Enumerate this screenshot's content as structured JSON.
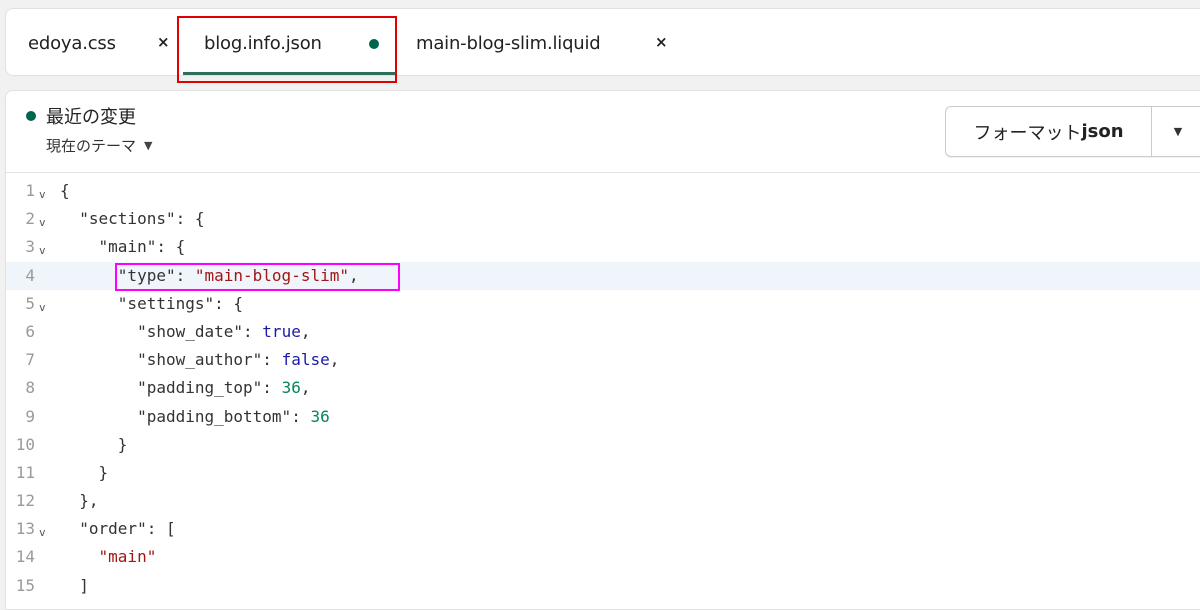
{
  "tabs": [
    {
      "label": "edoya.css",
      "close": "×"
    },
    {
      "label": "blog.info.json",
      "modified": true
    },
    {
      "label": "main-blog-slim.liquid",
      "close": "×"
    }
  ],
  "header": {
    "recent_changes": "最近の変更",
    "theme_select": "現在のテーマ",
    "format_button_prefix": "フォーマット",
    "format_button_suffix": "json"
  },
  "colors": {
    "accent": "#00654d",
    "annotation_red": "#e00000",
    "annotation_pink": "#ff00ff",
    "string": "#a31515",
    "keyword": "#1a1aa6",
    "number": "#098658"
  },
  "icons": {
    "modified_dot": "dot-icon",
    "close": "close-icon",
    "fold": "chevron-down-icon",
    "dropdown": "caret-down-icon"
  },
  "code": {
    "active_line": 4,
    "lines": [
      {
        "n": "1",
        "fold": true
      },
      {
        "n": "2",
        "fold": true
      },
      {
        "n": "3",
        "fold": true
      },
      {
        "n": "4",
        "fold": false
      },
      {
        "n": "5",
        "fold": true
      },
      {
        "n": "6",
        "fold": false
      },
      {
        "n": "7",
        "fold": false
      },
      {
        "n": "8",
        "fold": false
      },
      {
        "n": "9",
        "fold": false
      },
      {
        "n": "10",
        "fold": false
      },
      {
        "n": "11",
        "fold": false
      },
      {
        "n": "12",
        "fold": false
      },
      {
        "n": "13",
        "fold": true
      },
      {
        "n": "14",
        "fold": false
      },
      {
        "n": "15",
        "fold": false
      }
    ],
    "tokens": {
      "l1": "{",
      "l2_key": "\"sections\"",
      "l2_rest": ": {",
      "l3_key": "\"main\"",
      "l3_rest": ": {",
      "l4_key": "\"type\"",
      "l4_sep": ": ",
      "l4_val": "\"main-blog-slim\"",
      "l4_end": ",",
      "l5_key": "\"settings\"",
      "l5_rest": ": {",
      "l6_key": "\"show_date\"",
      "l6_sep": ": ",
      "l6_val": "true",
      "l6_end": ",",
      "l7_key": "\"show_author\"",
      "l7_sep": ": ",
      "l7_val": "false",
      "l7_end": ",",
      "l8_key": "\"padding_top\"",
      "l8_sep": ": ",
      "l8_val": "36",
      "l8_end": ",",
      "l9_key": "\"padding_bottom\"",
      "l9_sep": ": ",
      "l9_val": "36",
      "l10": "}",
      "l11": "}",
      "l12": "},",
      "l13_key": "\"order\"",
      "l13_rest": ": [",
      "l14_val": "\"main\"",
      "l15": "]"
    }
  }
}
